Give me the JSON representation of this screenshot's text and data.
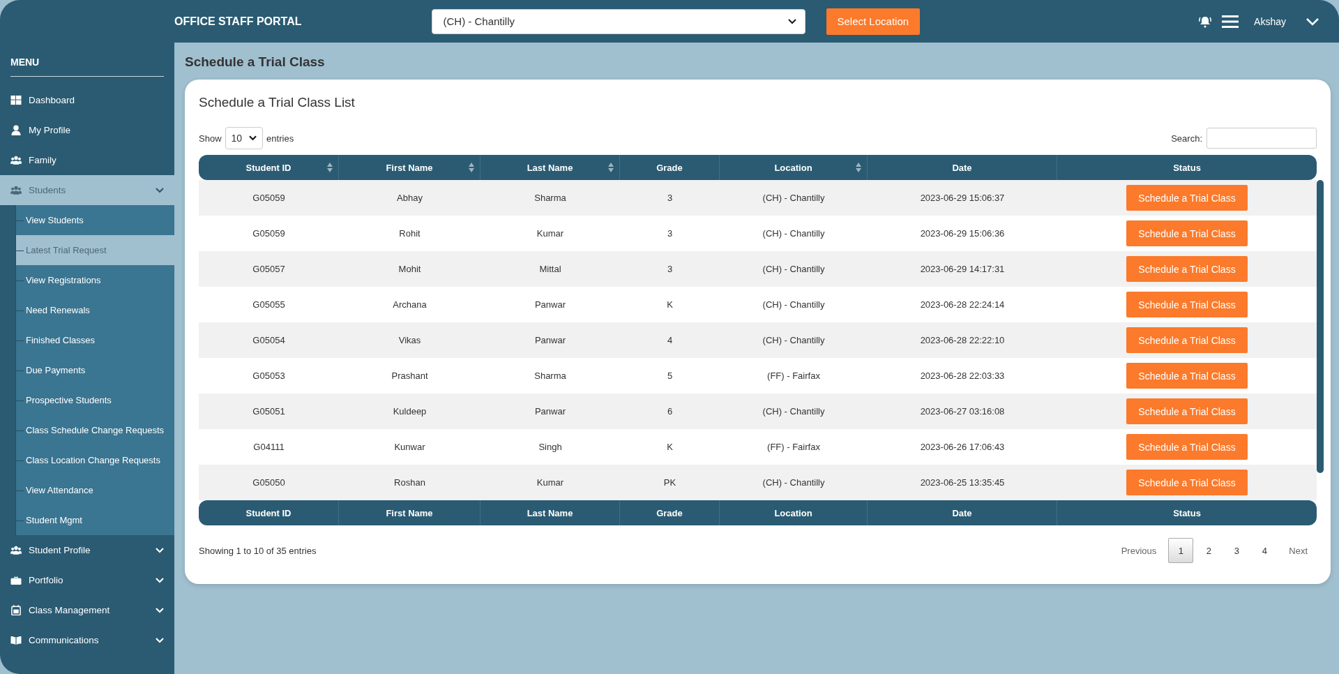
{
  "header": {
    "title": "OFFICE STAFF PORTAL",
    "location_select": {
      "value": "(CH) - Chantilly"
    },
    "select_button": "Select Location",
    "user_name": "Akshay"
  },
  "sidebar": {
    "heading": "MENU",
    "items": [
      {
        "label": "Dashboard",
        "kind": "link",
        "selected": false
      },
      {
        "label": "My Profile",
        "kind": "link",
        "selected": false
      },
      {
        "label": "Family",
        "kind": "link",
        "selected": false
      },
      {
        "label": "Students",
        "kind": "group",
        "selected": true,
        "children": [
          {
            "label": "View Students",
            "selected": false
          },
          {
            "label": "Latest Trial Request",
            "selected": true
          },
          {
            "label": "View Registrations",
            "selected": false
          },
          {
            "label": "Need Renewals",
            "selected": false
          },
          {
            "label": "Finished Classes",
            "selected": false
          },
          {
            "label": "Due Payments",
            "selected": false
          },
          {
            "label": "Prospective Students",
            "selected": false
          },
          {
            "label": "Class Schedule Change Requests",
            "selected": false
          },
          {
            "label": "Class Location Change Requests",
            "selected": false
          },
          {
            "label": "View Attendance",
            "selected": false
          },
          {
            "label": "Student Mgmt",
            "selected": false
          }
        ]
      },
      {
        "label": "Student Profile",
        "kind": "group",
        "selected": false
      },
      {
        "label": "Portfolio",
        "kind": "group",
        "selected": false
      },
      {
        "label": "Class Management",
        "kind": "group",
        "selected": false
      },
      {
        "label": "Communications",
        "kind": "group",
        "selected": false
      }
    ]
  },
  "page_title": "Schedule a Trial Class",
  "card": {
    "title": "Schedule a Trial Class List",
    "show_label": "Show",
    "page_size": "10",
    "entries_label": "entries",
    "search_label": "Search:",
    "table": {
      "columns": [
        {
          "label": "Student ID",
          "sortable": true
        },
        {
          "label": "First Name",
          "sortable": true
        },
        {
          "label": "Last Name",
          "sortable": true
        },
        {
          "label": "Grade",
          "sortable": false
        },
        {
          "label": "Location",
          "sortable": true
        },
        {
          "label": "Date",
          "sortable": false
        },
        {
          "label": "Status",
          "sortable": false
        }
      ],
      "rows": [
        {
          "student_id": "G05059",
          "first_name": "Abhay",
          "last_name": "Sharma",
          "grade": "3",
          "location": "(CH) - Chantilly",
          "date": "2023-06-29 15:06:37",
          "action": "Schedule a Trial Class"
        },
        {
          "student_id": "G05059",
          "first_name": "Rohit",
          "last_name": "Kumar",
          "grade": "3",
          "location": "(CH) - Chantilly",
          "date": "2023-06-29 15:06:36",
          "action": "Schedule a Trial Class"
        },
        {
          "student_id": "G05057",
          "first_name": "Mohit",
          "last_name": "Mittal",
          "grade": "3",
          "location": "(CH) - Chantilly",
          "date": "2023-06-29 14:17:31",
          "action": "Schedule a Trial Class"
        },
        {
          "student_id": "G05055",
          "first_name": "Archana",
          "last_name": "Panwar",
          "grade": "K",
          "location": "(CH) - Chantilly",
          "date": "2023-06-28 22:24:14",
          "action": "Schedule a Trial Class"
        },
        {
          "student_id": "G05054",
          "first_name": "Vikas",
          "last_name": "Panwar",
          "grade": "4",
          "location": "(CH) - Chantilly",
          "date": "2023-06-28 22:22:10",
          "action": "Schedule a Trial Class"
        },
        {
          "student_id": "G05053",
          "first_name": "Prashant",
          "last_name": "Sharma",
          "grade": "5",
          "location": "(FF) - Fairfax",
          "date": "2023-06-28 22:03:33",
          "action": "Schedule a Trial Class"
        },
        {
          "student_id": "G05051",
          "first_name": "Kuldeep",
          "last_name": "Panwar",
          "grade": "6",
          "location": "(CH) - Chantilly",
          "date": "2023-06-27 03:16:08",
          "action": "Schedule a Trial Class"
        },
        {
          "student_id": "G04111",
          "first_name": "Kunwar",
          "last_name": "Singh",
          "grade": "K",
          "location": "(FF) - Fairfax",
          "date": "2023-06-26 17:06:43",
          "action": "Schedule a Trial Class"
        },
        {
          "student_id": "G05050",
          "first_name": "Roshan",
          "last_name": "Kumar",
          "grade": "PK",
          "location": "(CH) - Chantilly",
          "date": "2023-06-25 13:35:45",
          "action": "Schedule a Trial Class"
        }
      ],
      "footer_columns": [
        "Student ID",
        "First Name",
        "Last Name",
        "Grade",
        "Location",
        "Date",
        "Status"
      ]
    },
    "info": "Showing 1 to 10 of 35 entries",
    "pagination": {
      "previous": "Previous",
      "pages": [
        {
          "label": "1",
          "selected": true
        },
        {
          "label": "2",
          "selected": false
        },
        {
          "label": "3",
          "selected": false
        },
        {
          "label": "4",
          "selected": false
        }
      ],
      "next": "Next"
    }
  }
}
